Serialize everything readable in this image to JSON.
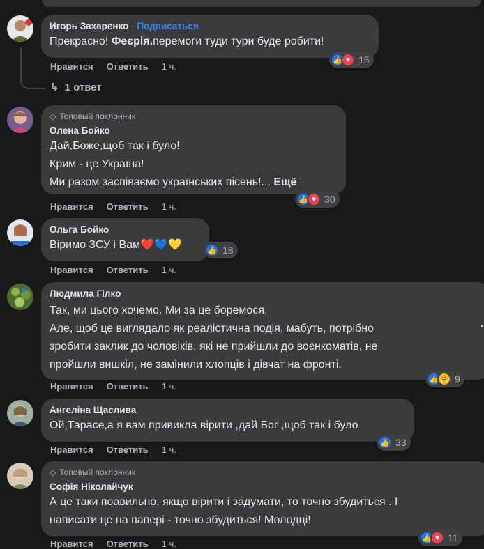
{
  "comments": [
    {
      "author": "Игорь Захаренко",
      "follow": "Подписаться",
      "text_parts": [
        "Прекрасно! ",
        "Феєрія.",
        "перемоги туди тури буде робити!"
      ],
      "like": "Нравится",
      "reply": "Ответить",
      "time": "1 ч.",
      "reactions": [
        "like-icon",
        "love-icon"
      ],
      "count": "15",
      "replies_label": "1 ответ"
    },
    {
      "badge": "Топовый поклонник",
      "author": "Олена Бойко",
      "lines": [
        "Дай,Боже,щоб так і було!",
        "Крим - це Україна!",
        "Ми разом заспіваємо українських пісень!..."
      ],
      "more": "Ещё",
      "like": "Нравится",
      "reply": "Ответить",
      "time": "1 ч.",
      "reactions": [
        "like-icon",
        "love-icon"
      ],
      "count": "30"
    },
    {
      "author": "Ольга Бойко",
      "text": "Віримо ЗСУ і Вам",
      "emoji": "❤️💙💛",
      "like": "Нравится",
      "reply": "Ответить",
      "time": "1 ч.",
      "reactions": [
        "like-icon"
      ],
      "count": "18"
    },
    {
      "author": "Людмила Гілко",
      "lines": [
        "Так, ми цього хочемо. Ми за це боремося.",
        "Але, щоб це виглядало як реалістична подія, мабуть, потрібно",
        "зробити заклик до чоловіків, які не прийшли до воєнкоматів, не",
        "пройшли вишкіл, не замінили хлопців і дівчат на фронті."
      ],
      "like": "Нравится",
      "reply": "Ответить",
      "time": "1 ч.",
      "reactions": [
        "like-icon",
        "care-icon"
      ],
      "count": "9"
    },
    {
      "author": "Ангеліна Щаслива",
      "text": "Ой,Тарасе,а я вам привикла вірити ,дай Бог ,щоб так і було",
      "like": "Нравится",
      "reply": "Ответить",
      "time": "1 ч.",
      "reactions": [
        "like-icon"
      ],
      "count": "33"
    },
    {
      "badge": "Топовый поклонник",
      "author": "Софія Ніколайчук",
      "lines": [
        "А це таки поавильно, якщо вірити і задумати, то точно збудиться . І",
        "написати це на папері - точно збудиться! Молодці!"
      ],
      "like": "Нравится",
      "reply": "Ответить",
      "time": "1 ч.",
      "reactions": [
        "like-icon",
        "love-icon"
      ],
      "count": "11"
    }
  ],
  "colors": {
    "background": "#18191a",
    "bubble": "#3a3b3c",
    "link": "#2d88ff",
    "like": "#1877f2",
    "love": "#f33e58"
  }
}
